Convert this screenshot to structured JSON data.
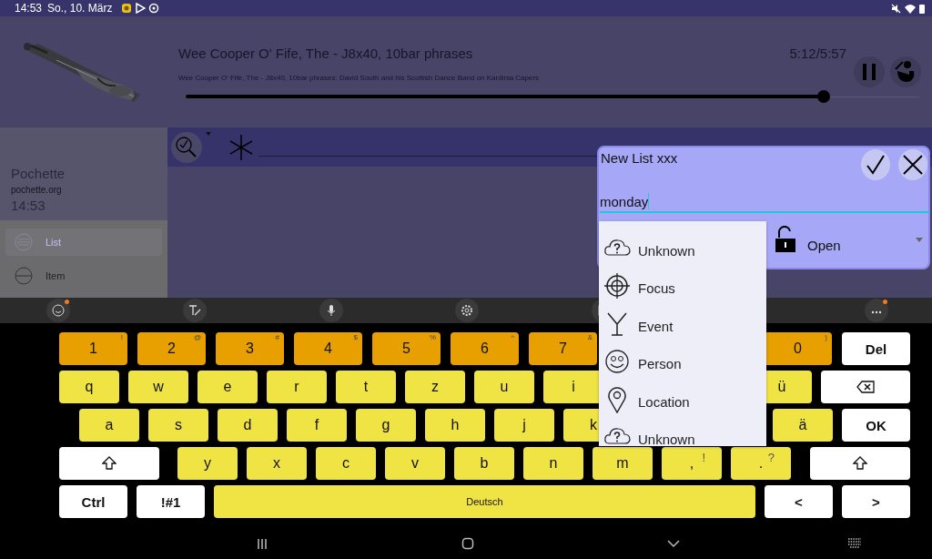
{
  "status_bar": {
    "time": "14:53",
    "date": "So., 10. März"
  },
  "player": {
    "title": "Wee Cooper O' Fife, The - J8x40, 10bar phrases",
    "subtitle": "Wee Cooper O' Fife, The - J8x40, 10bar phrases: David South and his Scottish Dance Band on Kardinia Capers",
    "time": "5:12/5:57",
    "level": 0.87,
    "playing": true
  },
  "drawer": {
    "app_name": "Pochette",
    "url": "pochette.org",
    "time": "14:53",
    "items": [
      {
        "label": "List",
        "selected": true
      },
      {
        "label": "Item",
        "selected": false
      }
    ]
  },
  "dialog": {
    "title": "New List xxx",
    "input": {
      "value": "monday"
    },
    "status": "Open",
    "dropdown": [
      {
        "label": "Unknown",
        "kind": "unknown"
      },
      {
        "label": "Focus",
        "kind": "focus"
      },
      {
        "label": "Event",
        "kind": "event"
      },
      {
        "label": "Person",
        "kind": "person"
      },
      {
        "label": "Location",
        "kind": "location"
      },
      {
        "label": "Unknown",
        "kind": "unknown"
      }
    ]
  },
  "keyboard": {
    "rows": [
      {
        "left": [
          {
            "label": "1",
            "hint": "!",
            "kind": "digit"
          },
          {
            "label": "2",
            "hint": "@",
            "kind": "digit"
          },
          {
            "label": "3",
            "hint": "#",
            "kind": "digit"
          },
          {
            "label": "4",
            "hint": "$",
            "kind": "digit"
          },
          {
            "label": "5",
            "hint": "%",
            "kind": "digit"
          },
          {
            "label": "6",
            "hint": "^",
            "kind": "digit"
          },
          {
            "label": "7",
            "hint": "&",
            "kind": "digit"
          }
        ],
        "right": [
          {
            "label": "0",
            "hint": ")",
            "kind": "digit"
          },
          {
            "label": "Del",
            "kind": "action"
          }
        ]
      },
      {
        "left": [
          {
            "label": "q",
            "kind": "letter"
          },
          {
            "label": "w",
            "kind": "letter"
          },
          {
            "label": "e",
            "kind": "letter"
          },
          {
            "label": "r",
            "kind": "letter"
          },
          {
            "label": "t",
            "kind": "letter"
          },
          {
            "label": "z",
            "kind": "letter"
          },
          {
            "label": "u",
            "kind": "letter"
          },
          {
            "label": "i",
            "kind": "letter"
          }
        ],
        "right": [
          {
            "label": "ü",
            "kind": "letter"
          },
          {
            "kind": "backspace"
          }
        ]
      },
      {
        "left": [
          {
            "label": "a",
            "kind": "letter"
          },
          {
            "label": "s",
            "kind": "letter"
          },
          {
            "label": "d",
            "kind": "letter"
          },
          {
            "label": "f",
            "kind": "letter"
          },
          {
            "label": "g",
            "kind": "letter"
          },
          {
            "label": "h",
            "kind": "letter"
          },
          {
            "label": "j",
            "kind": "letter"
          },
          {
            "label": "k",
            "kind": "letter"
          }
        ],
        "right": [
          {
            "label": "ä",
            "kind": "letter"
          },
          {
            "label": "OK",
            "kind": "action"
          }
        ]
      },
      {
        "left": [
          {
            "kind": "shift"
          },
          {
            "label": "y",
            "kind": "letter"
          },
          {
            "label": "x",
            "kind": "letter"
          },
          {
            "label": "c",
            "kind": "letter"
          },
          {
            "label": "v",
            "kind": "letter"
          },
          {
            "label": "b",
            "kind": "letter"
          },
          {
            "label": "n",
            "kind": "letter"
          },
          {
            "label": "m",
            "kind": "letter"
          },
          {
            "label": ",",
            "hint": "!",
            "kind": "letter"
          },
          {
            "label": ".",
            "hint": "?",
            "kind": "letter"
          }
        ],
        "right": [
          {
            "kind": "shift"
          }
        ]
      },
      {
        "left": [
          {
            "label": "Ctrl",
            "kind": "action"
          },
          {
            "label": "!#1",
            "kind": "action"
          },
          {
            "label": "Deutsch",
            "kind": "space"
          },
          {
            "label": "<",
            "kind": "action"
          },
          {
            "label": ">",
            "kind": "action"
          }
        ],
        "right": []
      }
    ]
  }
}
